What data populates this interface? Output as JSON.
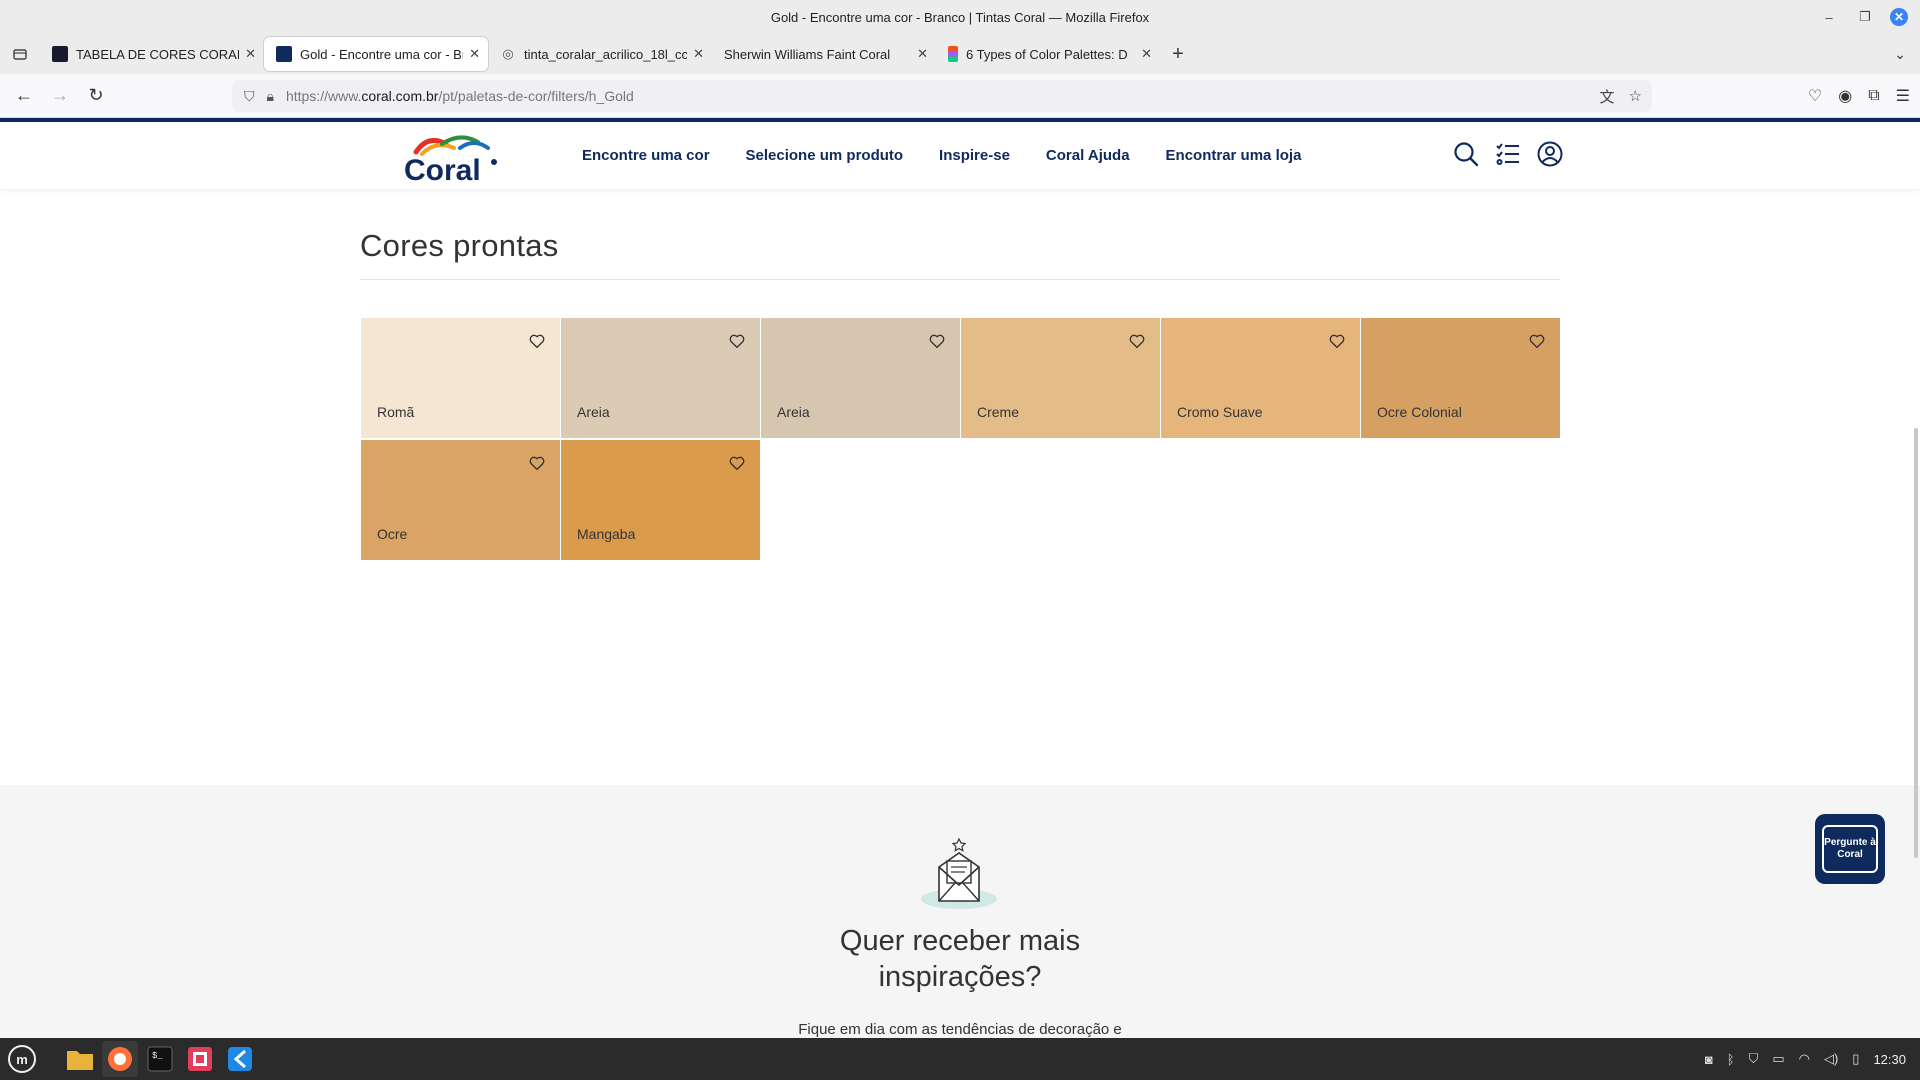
{
  "window": {
    "title": "Gold - Encontre uma cor - Branco | Tintas Coral — Mozilla Firefox"
  },
  "tabs": [
    {
      "label": "TABELA DE CORES CORAL –",
      "favicon_color": "#1a1a2e"
    },
    {
      "label": "Gold - Encontre uma cor - Br",
      "favicon_color": "#0f2a5c"
    },
    {
      "label": "tinta_coralar_acrilico_18l_cc",
      "favicon_color": ""
    },
    {
      "label": "Sherwin Williams Faint Coral",
      "favicon_color": ""
    },
    {
      "label": "6 Types of Color Palettes: D",
      "favicon_color": "#f24e1e"
    }
  ],
  "navbar": {
    "url_prefix": "https://www.",
    "url_domain": "coral.com.br",
    "url_path": "/pt/paletas-de-cor/filters/h_Gold"
  },
  "site": {
    "nav": [
      "Encontre uma cor",
      "Selecione um produto",
      "Inspire-se",
      "Coral Ajuda",
      "Encontrar uma loja"
    ],
    "brand_color": "#0f2a5c"
  },
  "section": {
    "title": "Cores prontas"
  },
  "swatches": [
    {
      "name": "Romã",
      "color": "#f5e6d3"
    },
    {
      "name": "Areia",
      "color": "#dccbb4"
    },
    {
      "name": "Areia",
      "color": "#d6c6b0"
    },
    {
      "name": "Creme",
      "color": "#e4bc88"
    },
    {
      "name": "Cromo Suave",
      "color": "#e6b57c"
    },
    {
      "name": "Ocre Colonial",
      "color": "#d6a063"
    },
    {
      "name": "Ocre",
      "color": "#d9a464"
    },
    {
      "name": "Mangaba",
      "color": "#db9b4c"
    }
  ],
  "newsletter": {
    "title": "Quer receber mais inspirações?",
    "subtitle": "Fique em dia com as tendências de decoração e"
  },
  "chat": {
    "label": "Pergunte à Coral"
  },
  "taskbar": {
    "clock": "12:30"
  }
}
